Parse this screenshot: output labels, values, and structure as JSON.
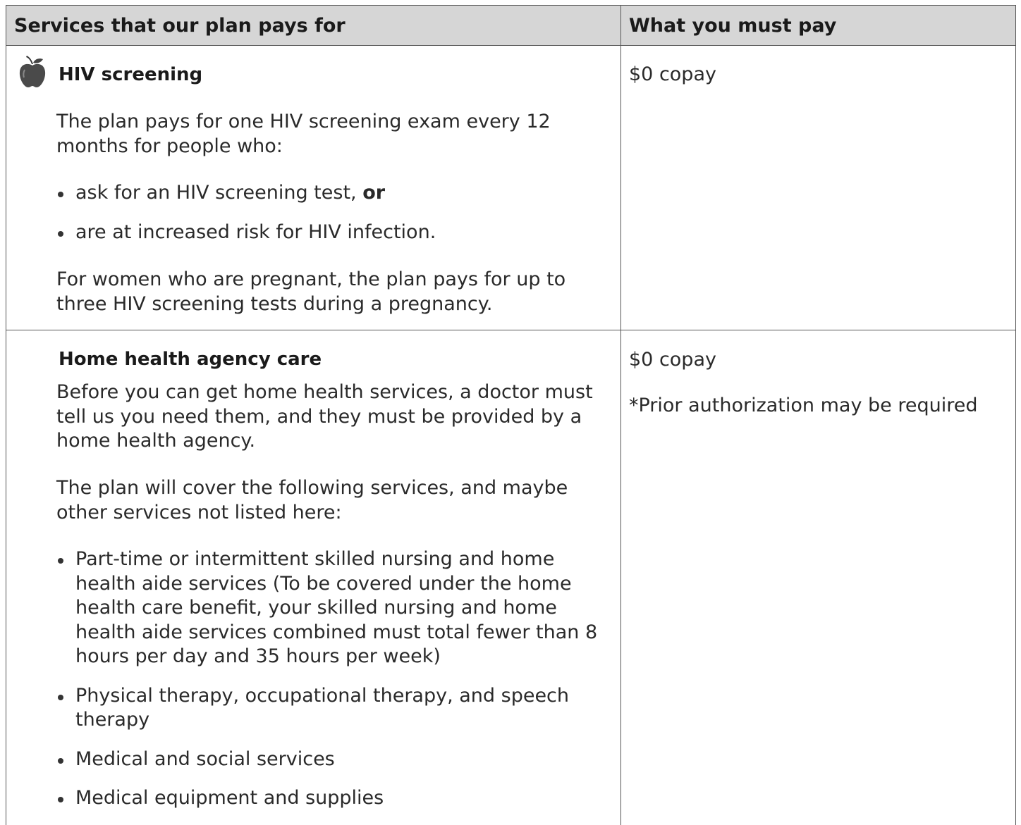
{
  "header": {
    "col1": "Services that our plan pays for",
    "col2": "What you must pay"
  },
  "rows": [
    {
      "icon": "apple-icon",
      "title": "HIV screening",
      "intro": "The plan pays for one HIV screening exam every 12 months for people who:",
      "bullets": [
        {
          "text": "ask for an HIV screening test, ",
          "bold_suffix": "or"
        },
        {
          "text": "are at increased risk for HIV infection."
        }
      ],
      "closing": "For women who are pregnant, the plan pays for up to three HIV screening tests during a pregnancy.",
      "cost": [
        "$0 copay"
      ]
    },
    {
      "title": "Home health agency care",
      "intro": "Before you can get home health services, a doctor must tell us you need them, and they must be provided by a home health agency.",
      "intro2": "The plan will cover the following services, and maybe other services not listed here:",
      "bullets": [
        {
          "text": "Part-time or intermittent skilled nursing and home health aide services (To be covered under the home health care benefit, your skilled nursing and home health aide services combined must total fewer than 8 hours per day and 35 hours per week)"
        },
        {
          "text": "Physical therapy, occupational therapy, and speech therapy"
        },
        {
          "text": "Medical and social services"
        },
        {
          "text": "Medical equipment and supplies"
        }
      ],
      "cost": [
        "$0 copay",
        "*Prior authorization may be required"
      ]
    }
  ]
}
